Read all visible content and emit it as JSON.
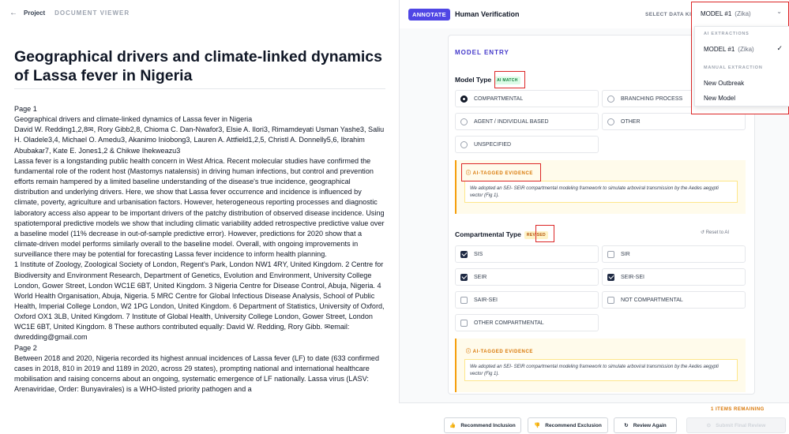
{
  "left": {
    "back_icon": "arrow-left-icon",
    "project": "Project",
    "viewer": "DOCUMENT VIEWER",
    "title": "Geographical drivers and climate-linked dynamics of Lassa fever in Nigeria",
    "body": [
      "Page 1",
      "Geographical drivers and climate-linked dynamics of Lassa fever in Nigeria",
      "David W. Redding1,2,8✉, Rory Gibb2,8, Chioma C. Dan-Nwafor3, Elsie A. Ilori3, Rimamdeyati Usman Yashe3, Saliu H. Oladele3,4, Michael O. Amedu3, Akanimo Iniobong3, Lauren A. Attfield1,2,5, Christl A. Donnelly5,6, Ibrahim Abubakar7, Kate E. Jones1,2 & Chikwe Ihekweazu3",
      "Lassa fever is a longstanding public health concern in West Africa. Recent molecular studies have confirmed the fundamental role of the rodent host (Mastomys natalensis) in driving human infections, but control and prevention efforts remain hampered by a limited baseline understanding of the disease's true incidence, geographical distribution and underlying drivers. Here, we show that Lassa fever occurrence and incidence is influenced by climate, poverty, agriculture and urbanisation factors. However, heterogeneous reporting processes and diagnostic laboratory access also appear to be important drivers of the patchy distribution of observed disease incidence. Using spatiotemporal predictive models we show that including climatic variability added retrospective predictive value over a baseline model (11% decrease in out-of-sample predictive error). However, predictions for 2020 show that a climate-driven model performs similarly overall to the baseline model. Overall, with ongoing improvements in surveillance there may be potential for forecasting Lassa fever incidence to inform health planning.",
      "1 Institute of Zoology, Zoological Society of London, Regent's Park, London NW1 4RY, United Kingdom. 2 Centre for Biodiversity and Environment Research, Department of Genetics, Evolution and Environment, University College London, Gower Street, London WC1E 6BT, United Kingdom. 3 Nigeria Centre for Disease Control, Abuja, Nigeria. 4 World Health Organisation, Abuja, Nigeria. 5 MRC Centre for Global Infectious Disease Analysis, School of Public Health, Imperial College London, W2 1PG London, United Kingdom. 6 Department of Statistics, University of Oxford, Oxford OX1 3LB, United Kingdom. 7 Institute of Global Health, University College London, Gower Street, London WC1E 6BT, United Kingdom. 8 These authors contributed equally: David W. Redding, Rory Gibb. ✉email: dwredding@gmail.com",
      "Page 2",
      "Between 2018 and 2020, Nigeria recorded its highest annual incidences of Lassa fever (LF) to date (633 confirmed cases in 2018, 810 in 2019 and 1189 in 2020, across 29 states), prompting national and international healthcare mobilisation and raising concerns about an ongoing, systematic emergence of LF nationally. Lassa virus (LASV: Arenaviridae, Order: Bunyavirales) is a WHO-listed priority pathogen and a"
    ]
  },
  "header": {
    "annotate": "ANNOTATE",
    "title": "Human Verification",
    "select_data_kind": "SELECT DATA KIND"
  },
  "model_entry": "MODEL ENTRY",
  "model_type": {
    "label": "Model Type",
    "badge": "AI MATCH",
    "options": [
      "COMPARTMENTAL",
      "BRANCHING PROCESS",
      "AGENT / INDIVIDUAL BASED",
      "OTHER",
      "UNSPECIFIED"
    ],
    "selected": "COMPARTMENTAL"
  },
  "evidence1": {
    "title": "AI-TAGGED EVIDENCE",
    "text": "We adopted an SEI- SEIR compartmental modeling framework to simulate arboviral transmission by the Aedes aegypti vector (Fig 1)."
  },
  "compartmental_type": {
    "label": "Compartmental Type",
    "badge": "REVISED",
    "reset": "Reset to AI",
    "options": [
      "SIS",
      "SIR",
      "SEIR",
      "SEIR-SEI",
      "SAIR-SEI",
      "NOT COMPARTMENTAL",
      "OTHER COMPARTMENTAL"
    ],
    "checked": [
      "SIS",
      "SEIR",
      "SEIR-SEI"
    ]
  },
  "evidence2": {
    "title": "AI-TAGGED EVIDENCE",
    "text": "We adopted an SEI- SEIR compartmental modeling framework to simulate arboviral transmission by the Aedes aegypti vector (Fig 1)."
  },
  "footer": {
    "remaining": "1 ITEMS REMAINING",
    "recommend_inclusion": "Recommend Inclusion",
    "recommend_exclusion": "Recommend Exclusion",
    "review_again": "Review Again",
    "submit": "Submit Final Review"
  },
  "dropdown": {
    "selected_main": "MODEL #1",
    "selected_sub": "(Zika)",
    "group_ai": "AI EXTRACTIONS",
    "ai_item_main": "MODEL #1",
    "ai_item_sub": "(Zika)",
    "group_manual": "MANUAL EXTRACTION",
    "manual_items": [
      "New Outbreak",
      "New Model"
    ]
  }
}
